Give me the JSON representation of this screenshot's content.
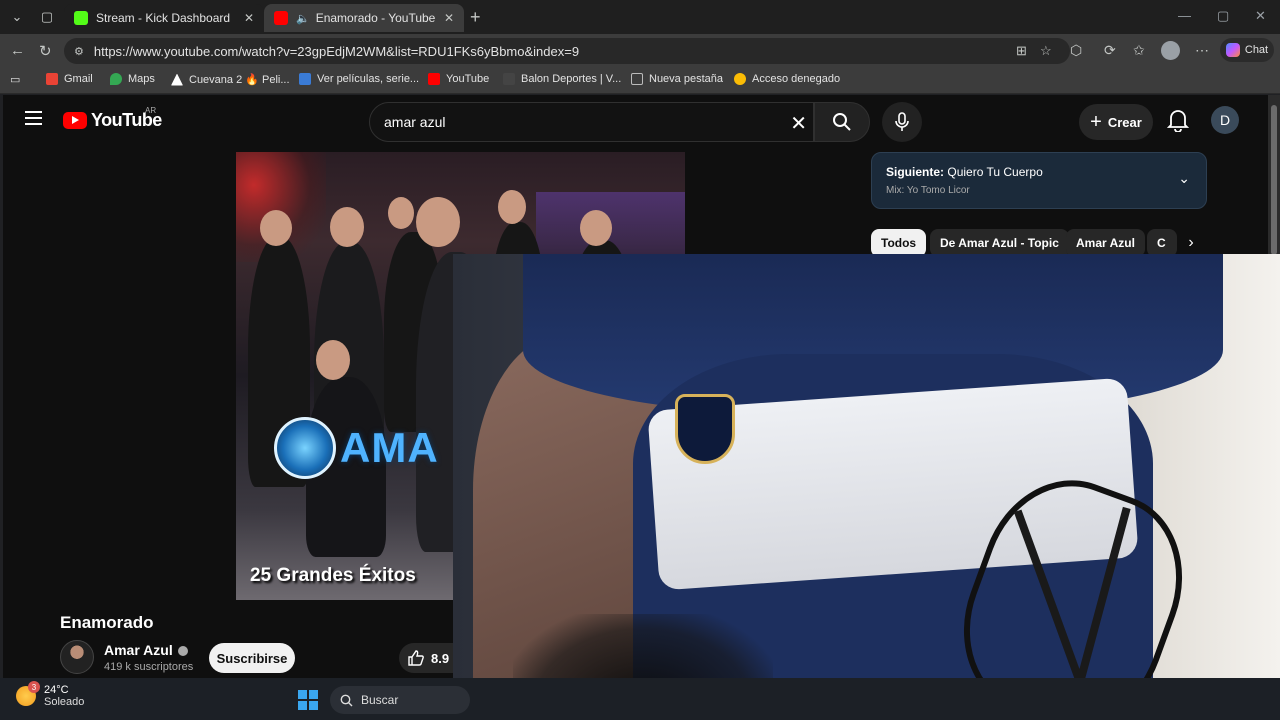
{
  "browser": {
    "tabs": [
      {
        "label": "Stream - Kick Dashboard",
        "favicon_color": "#53fc18",
        "active": false
      },
      {
        "label": "Enamorado - YouTube",
        "favicon_color": "#ff0000",
        "active": true
      }
    ],
    "url": "https://www.youtube.com/watch?v=23gpEdjM2WM&list=RDU1FKs6yBbmo&index=9",
    "chat_label": "Chat",
    "bookmarks": [
      {
        "label": "Gmail",
        "color": "#ea4335"
      },
      {
        "label": "Maps",
        "color": "#34a853"
      },
      {
        "label": "Cuevana 2 🔥 Peli...",
        "color": "#ffffff"
      },
      {
        "label": "Ver películas, serie...",
        "color": "#3a7bd5"
      },
      {
        "label": "YouTube",
        "color": "#ff0000"
      },
      {
        "label": "Balon Deportes | V...",
        "color": "#444444"
      },
      {
        "label": "Nueva pestaña",
        "color": "#bbbbbb"
      },
      {
        "label": "Acceso denegado",
        "color": "#fbbc05"
      }
    ]
  },
  "youtube": {
    "logo_text": "YouTube",
    "country": "AR",
    "search_value": "amar azul",
    "create_label": "Crear",
    "user_initial": "D",
    "video_caption": "25 Grandes Éxitos",
    "video_logo_text": "AMA",
    "video_title": "Enamorado",
    "channel_name": "Amar Azul",
    "channel_subs": "419 k suscriptores",
    "subscribe_label": "Suscribirse",
    "likes": "8.9",
    "next": {
      "prefix": "Siguiente:",
      "title": "Quiero Tu Cuerpo",
      "mix": "Mix: Yo Tomo Licor"
    },
    "chips": [
      "Todos",
      "De Amar Azul - Topic",
      "Amar Azul",
      "C"
    ]
  },
  "taskbar": {
    "temperature": "24°C",
    "condition": "Soleado",
    "weather_badge": "3",
    "search_label": "Buscar"
  }
}
